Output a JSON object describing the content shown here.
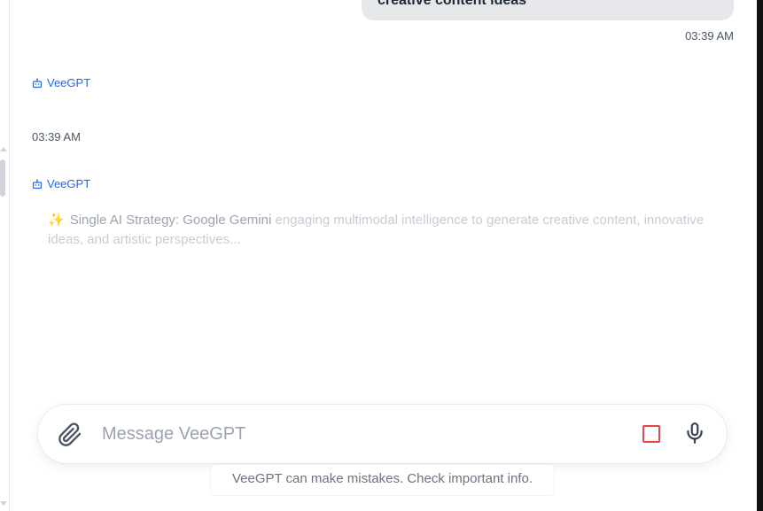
{
  "conversation": {
    "user_message": "creative content ideas",
    "user_time": "03:39 AM",
    "assistant_name": "VeeGPT",
    "assistant_time": "03:39 AM",
    "streaming_sparkle": "✨",
    "streaming_text_main": "Single AI Strategy: Google Gemini",
    "streaming_text_rest": " engaging multimodal intelligence to generate creative content, innovative ideas, and artistic perspectives..."
  },
  "composer": {
    "placeholder": "Message VeeGPT",
    "attach_icon": "paperclip-icon",
    "stop_icon": "stop-square-icon",
    "mic_icon": "microphone-icon"
  },
  "footer": {
    "disclaimer": "VeeGPT can make mistakes. Check important info."
  },
  "colors": {
    "accent": "#2563eb",
    "stop": "#ef4444",
    "bubble": "#e5e7eb"
  }
}
